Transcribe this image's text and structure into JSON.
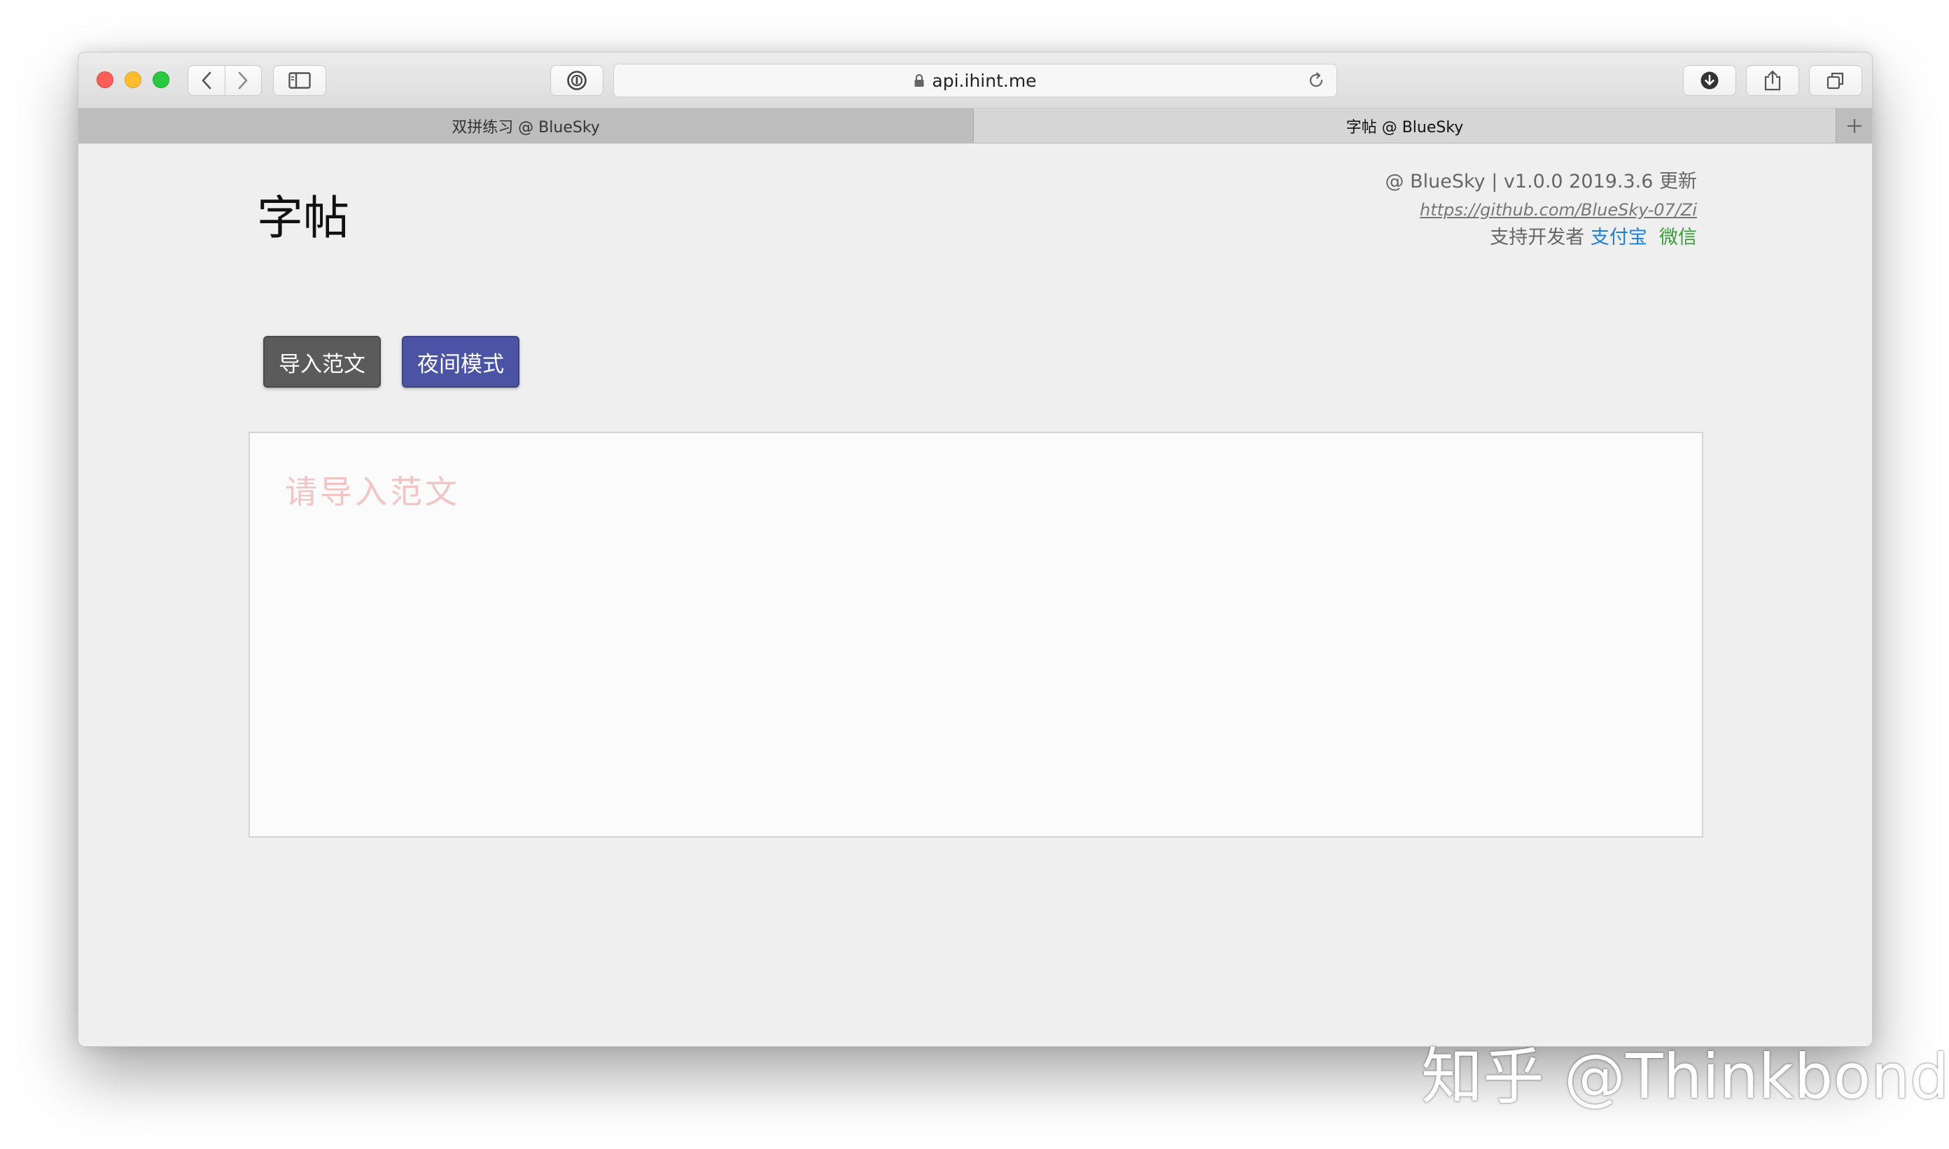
{
  "browser": {
    "address": "api.ihint.me",
    "tabs": [
      {
        "label": "双拼练习 @ BlueSky"
      },
      {
        "label": "字帖 @ BlueSky"
      }
    ]
  },
  "page": {
    "title": "字帖",
    "meta": {
      "line1": "@ BlueSky | v1.0.0 2019.3.6 更新",
      "link": "https://github.com/BlueSky-07/Zi",
      "support_label": "支持开发者",
      "alipay": "支付宝",
      "wechat": "微信"
    },
    "buttons": {
      "import": "导入范文",
      "night": "夜间模式"
    },
    "editor": {
      "placeholder": "请导入范文"
    }
  },
  "watermark": "知乎 @Thinkbond",
  "colors": {
    "night_button": "#4a53a4",
    "import_button": "#5b5b5b",
    "placeholder": "#f2c4c4",
    "alipay": "#1e7fd6",
    "wechat": "#3a9b3a"
  }
}
